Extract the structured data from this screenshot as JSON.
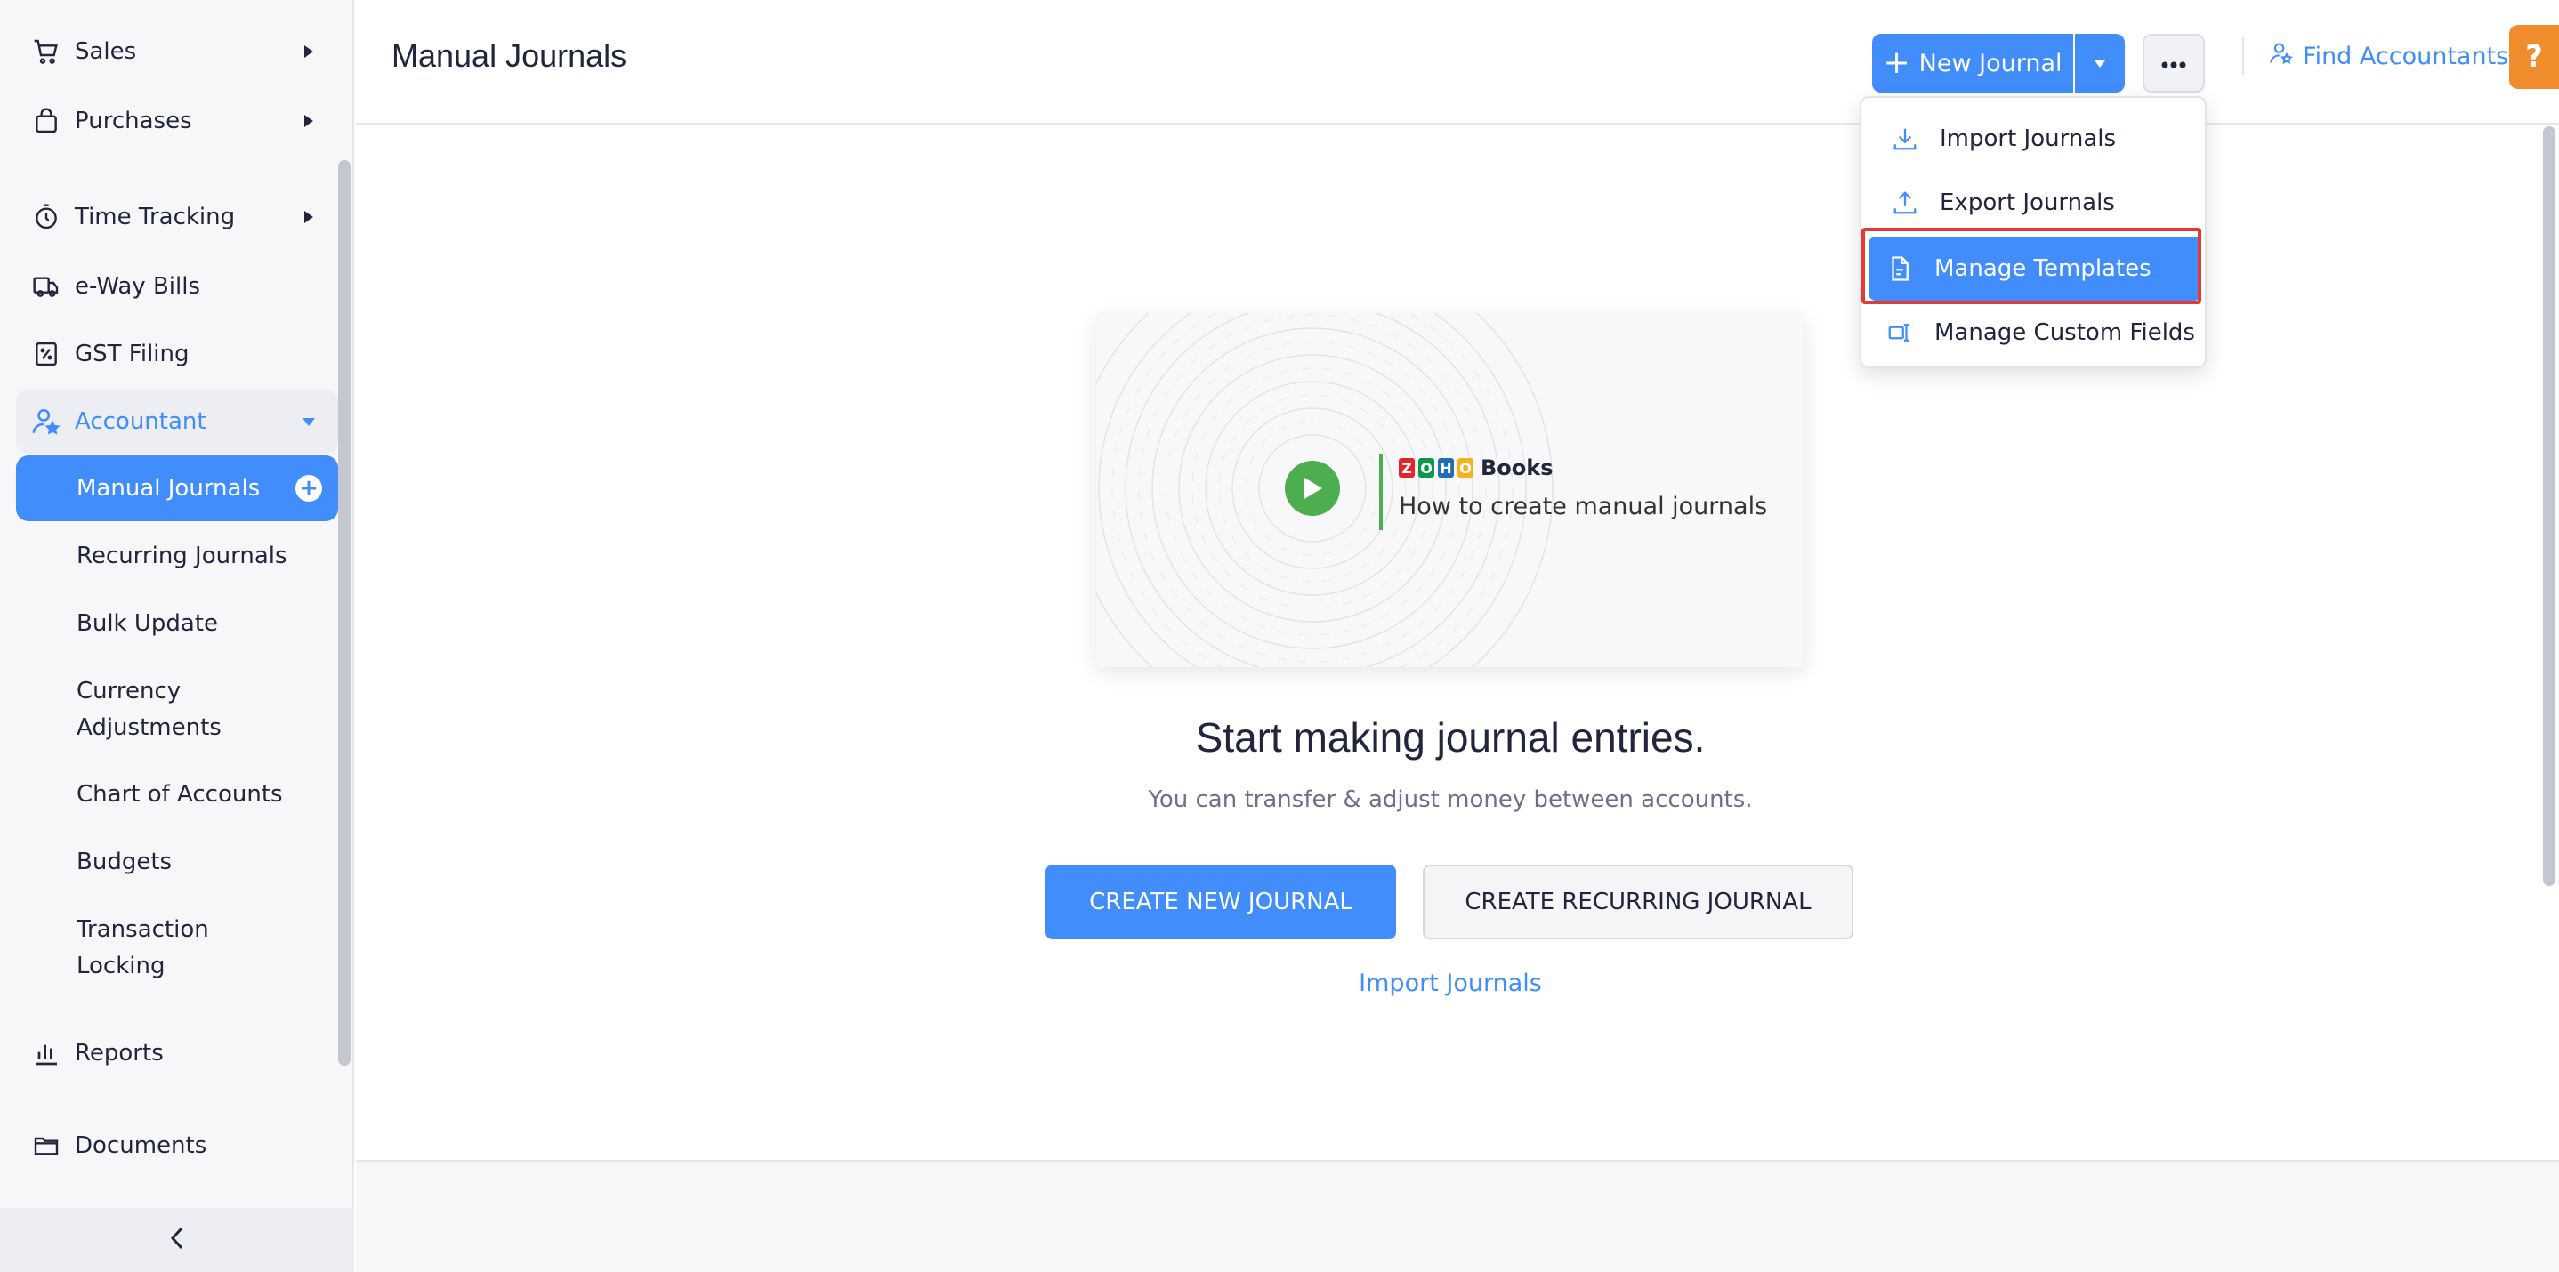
{
  "sidebar": {
    "items": [
      {
        "label": "Sales",
        "icon": "cart-icon"
      },
      {
        "label": "Purchases",
        "icon": "bag-icon"
      },
      {
        "label": "Time Tracking",
        "icon": "stopwatch-icon"
      },
      {
        "label": "e-Way Bills",
        "icon": "truck-icon"
      },
      {
        "label": "GST Filing",
        "icon": "percent-document-icon"
      },
      {
        "label": "Accountant",
        "icon": "accountant-icon"
      },
      {
        "label": "Reports",
        "icon": "bar-chart-icon"
      },
      {
        "label": "Documents",
        "icon": "folder-icon"
      }
    ],
    "accountant_sub": [
      {
        "label": "Manual Journals"
      },
      {
        "label": "Recurring Journals"
      },
      {
        "label": "Bulk Update"
      },
      {
        "label": "Currency Adjustments"
      },
      {
        "label": "Chart of Accounts"
      },
      {
        "label": "Budgets"
      },
      {
        "label": "Transaction Locking"
      }
    ]
  },
  "header": {
    "title": "Manual Journals",
    "new_journal_label": "New Journal",
    "find_accountants_label": "Find Accountants",
    "help_label": "?"
  },
  "dropdown": {
    "items": [
      {
        "label": "Import Journals",
        "icon": "download-icon"
      },
      {
        "label": "Export Journals",
        "icon": "upload-icon"
      },
      {
        "label": "Manage Templates",
        "icon": "document-icon"
      },
      {
        "label": "Manage Custom Fields",
        "icon": "custom-fields-icon"
      }
    ],
    "highlighted": "Manage Templates"
  },
  "main": {
    "video_brand": "Books",
    "video_logo_letters": [
      "Z",
      "O",
      "H",
      "O"
    ],
    "video_caption": "How to create manual journals",
    "empty_title": "Start making journal entries.",
    "empty_subtitle": "You can transfer & adjust money between accounts.",
    "create_button": "CREATE NEW JOURNAL",
    "recurring_button": "CREATE RECURRING JOURNAL",
    "import_link": "Import Journals"
  },
  "colors": {
    "accent": "#408dfb",
    "highlight_border": "#e53935",
    "help_orange": "#f08c2b",
    "play_green": "#4cae4f"
  }
}
